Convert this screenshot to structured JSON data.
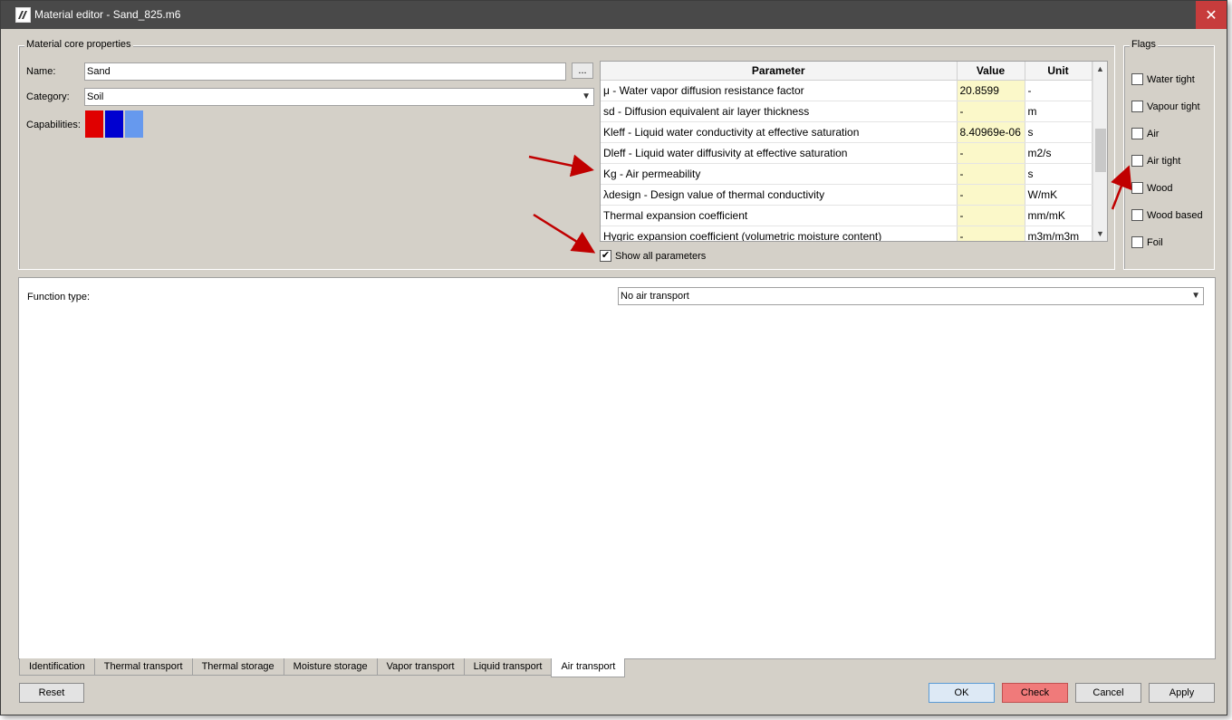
{
  "window": {
    "title": "Material editor - Sand_825.m6",
    "close_glyph": "✕"
  },
  "core": {
    "group_title": "Material core properties",
    "name_label": "Name:",
    "name_value": "Sand",
    "name_browse": "...",
    "category_label": "Category:",
    "category_value": "Soil",
    "capabilities_label": "Capabilities:",
    "capability_colors": [
      "#e00000",
      "#0000d0",
      "#6699ee"
    ]
  },
  "params": {
    "headers": [
      "Parameter",
      "Value",
      "Unit"
    ],
    "rows": [
      {
        "param": "μ - Water vapor diffusion resistance factor",
        "value": "20.8599",
        "unit": "-"
      },
      {
        "param": "sd - Diffusion equivalent air layer thickness",
        "value": "-",
        "unit": "m"
      },
      {
        "param": "Kleff - Liquid water conductivity at effective saturation",
        "value": "8.40969e-06",
        "unit": "s"
      },
      {
        "param": "Dleff - Liquid water diffusivity at effective saturation",
        "value": "-",
        "unit": "m2/s"
      },
      {
        "param": "Kg - Air permeability",
        "value": "-",
        "unit": "s"
      },
      {
        "param": "λdesign - Design value of thermal conductivity",
        "value": "-",
        "unit": "W/mK"
      },
      {
        "param": "Thermal expansion coefficient",
        "value": "-",
        "unit": "mm/mK"
      },
      {
        "param": "Hygric expansion coefficient (volumetric moisture content)",
        "value": "-",
        "unit": "m3m/m3m"
      }
    ],
    "show_all_label": "Show all parameters",
    "show_all_checked": "✔"
  },
  "flags": {
    "group_title": "Flags",
    "items": [
      "Water tight",
      "Vapour tight",
      "Air",
      "Air tight",
      "Wood",
      "Wood based",
      "Foil"
    ]
  },
  "function": {
    "label": "Function type:",
    "value": "No air transport"
  },
  "tabs": [
    "Identification",
    "Thermal transport",
    "Thermal storage",
    "Moisture storage",
    "Vapor transport",
    "Liquid transport",
    "Air transport"
  ],
  "buttons": {
    "reset": "Reset",
    "ok": "OK",
    "check": "Check",
    "cancel": "Cancel",
    "apply": "Apply"
  },
  "icons": {
    "dropdown": "▼",
    "scroll_up": "▲",
    "scroll_down": "▼"
  },
  "colors": {
    "value_cell": "#fbf8c9",
    "annotation_arrow": "#c00000"
  }
}
